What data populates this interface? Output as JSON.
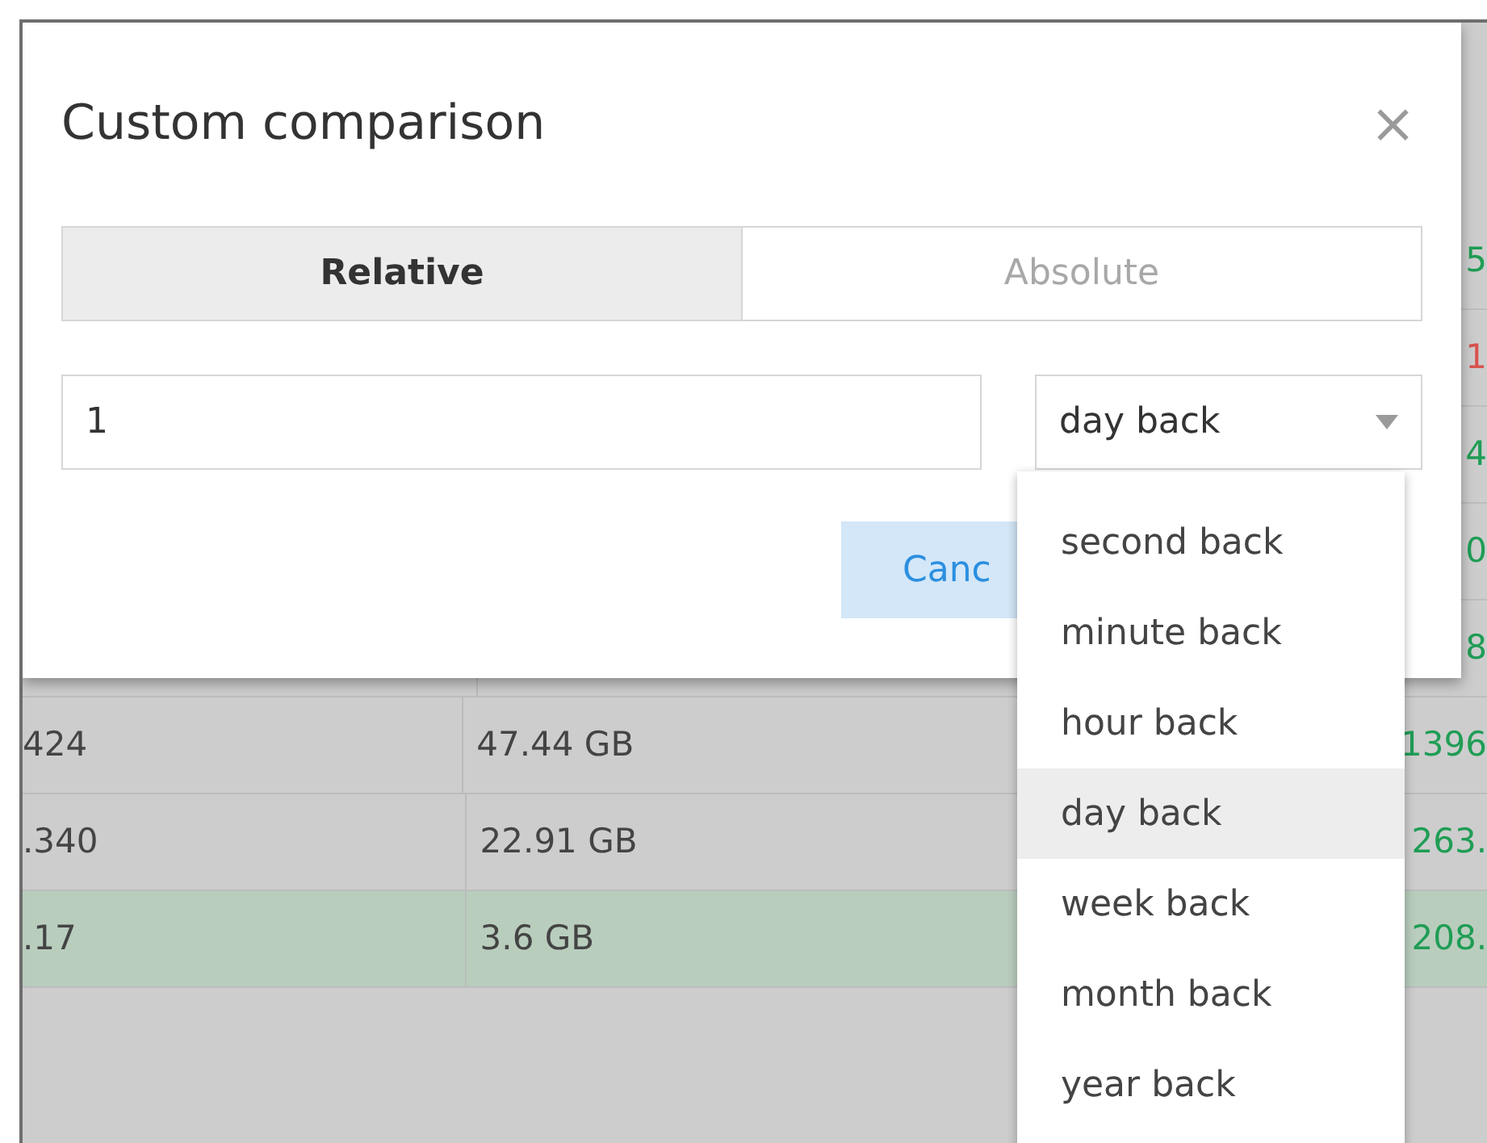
{
  "table": {
    "rows": [
      {
        "column_3": "5",
        "color": "#1f9d55",
        "selected": false
      },
      {
        "column_3": "1",
        "color": "#d9534f",
        "selected": false
      },
      {
        "column_3": "4",
        "color": "#1f9d55",
        "selected": false
      },
      {
        "column_3": "0",
        "color": "#1f9d55",
        "selected": false
      },
      {
        "column_3": "8",
        "color": "#1f9d55",
        "selected": false
      },
      {
        "column_1": "424",
        "column_2": "47.44 GB",
        "column_3": "1396",
        "color": "#1f9d55",
        "selected": false
      },
      {
        "column_1": ".340",
        "column_2": "22.91 GB",
        "column_3": "263.",
        "color": "#1f9d55",
        "selected": false
      },
      {
        "column_1": ".17",
        "column_2": "3.6 GB",
        "column_3": "208.",
        "color": "#1f9d55",
        "selected": true
      }
    ]
  },
  "dialog": {
    "title": "Custom comparison",
    "close": "×",
    "tabs": [
      {
        "label": "Relative",
        "selected": true
      },
      {
        "label": "Absolute",
        "selected": false
      }
    ],
    "amount": {
      "value": "1"
    },
    "unit": {
      "value": "day back",
      "expanded": true,
      "options": [
        {
          "label": "second back",
          "selected": false
        },
        {
          "label": "minute back",
          "selected": false
        },
        {
          "label": "hour back",
          "selected": false
        },
        {
          "label": "day back",
          "selected": true
        },
        {
          "label": "week back",
          "selected": false
        },
        {
          "label": "month back",
          "selected": false
        },
        {
          "label": "year back",
          "selected": false
        }
      ]
    },
    "buttons": [
      {
        "label": "Canc"
      }
    ]
  }
}
